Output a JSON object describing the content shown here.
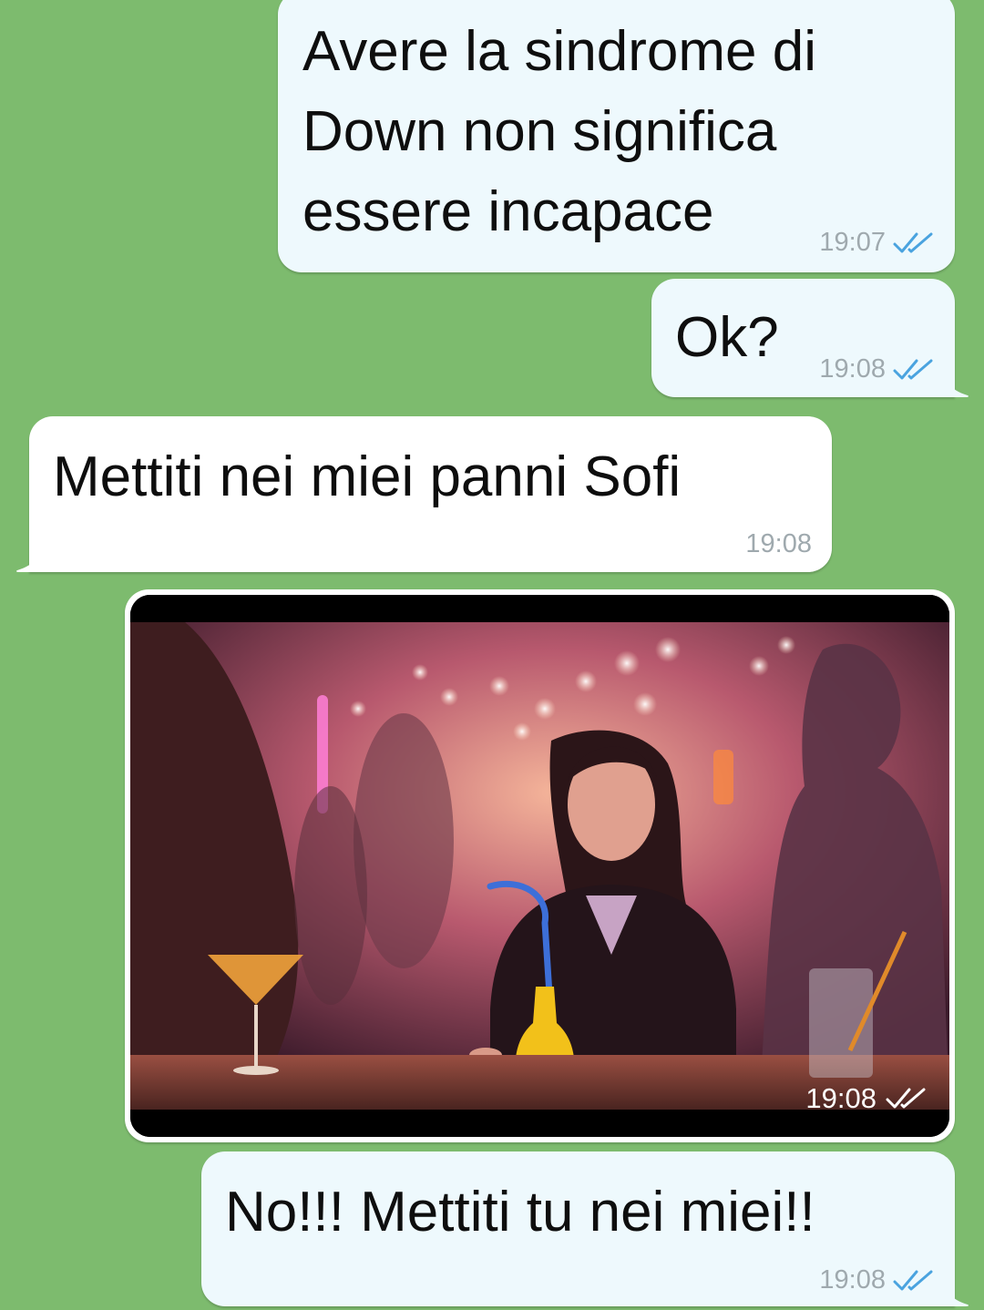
{
  "messages": [
    {
      "direction": "outgoing",
      "lines": [
        "Avere la sindrome di",
        "Down non significa",
        "essere incapace"
      ],
      "time": "19:07",
      "status": "read"
    },
    {
      "direction": "outgoing",
      "lines": [
        "Ok?"
      ],
      "time": "19:08",
      "status": "read"
    },
    {
      "direction": "incoming",
      "lines": [
        "Mettiti nei miei panni Sofi"
      ],
      "time": "19:08"
    },
    {
      "direction": "outgoing",
      "type": "image",
      "image_icon": "photo-of-girl-at-bar",
      "time": "19:08",
      "status": "read"
    },
    {
      "direction": "outgoing",
      "lines": [
        "No!!! Mettiti tu nei miei!!"
      ],
      "time": "19:08",
      "status": "read"
    }
  ],
  "colors": {
    "chat_background": "#7dbb6e",
    "outgoing_bubble": "#eef9fd",
    "incoming_bubble": "#ffffff",
    "read_ticks": "#4aa3df",
    "timestamp": "#9fa9ae"
  }
}
